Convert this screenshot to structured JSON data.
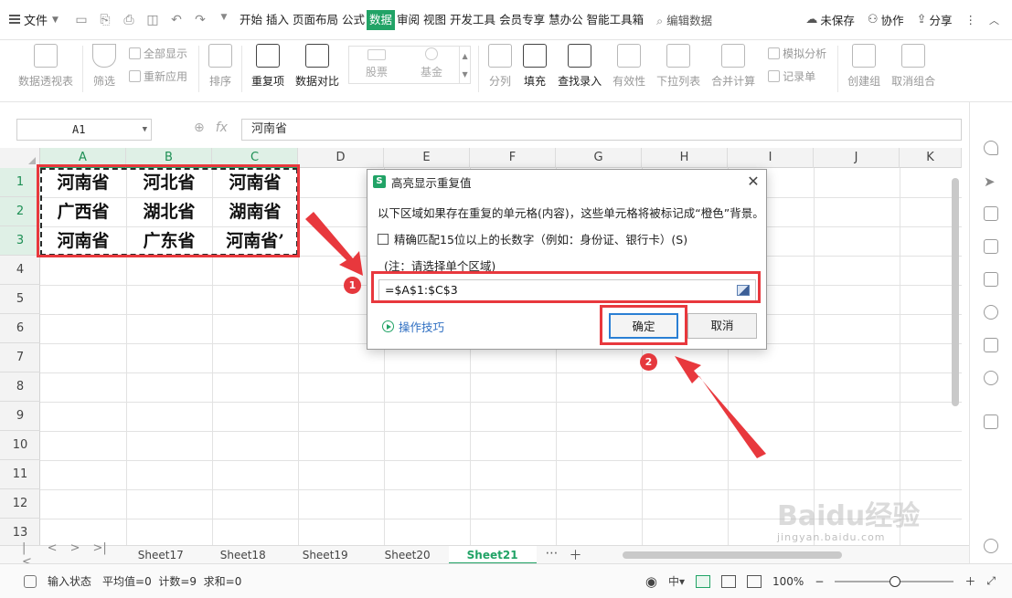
{
  "menu": {
    "file_label": "文件",
    "tabs": [
      "开始",
      "插入",
      "页面布局",
      "公式",
      "数据",
      "审阅",
      "视图",
      "开发工具",
      "会员专享",
      "慧办公",
      "智能工具箱"
    ],
    "active_tab": "数据",
    "command_search": "编辑数据",
    "unsaved": "未保存",
    "collab": "协作",
    "share": "分享"
  },
  "ribbon": {
    "pivot": "数据透视表",
    "filter": "筛选",
    "show_all": "全部显示",
    "reapply": "重新应用",
    "sort": "排序",
    "duplicates": "重复项",
    "compare": "数据对比",
    "stock": "股票",
    "fund": "基金",
    "split": "分列",
    "fill": "填充",
    "lookup": "查找录入",
    "validity": "有效性",
    "dropdown": "下拉列表",
    "consolidate": "合并计算",
    "simulate": "模拟分析",
    "record": "记录单",
    "group": "创建组",
    "ungroup": "取消组合"
  },
  "formula_bar": {
    "cell_ref": "A1",
    "fx": "fx",
    "content": "河南省"
  },
  "grid": {
    "columns": [
      "A",
      "B",
      "C",
      "D",
      "E",
      "F",
      "G",
      "H",
      "I",
      "J",
      "K"
    ],
    "rows": [
      "1",
      "2",
      "3",
      "4",
      "5",
      "6",
      "7",
      "8",
      "9",
      "10",
      "11",
      "12",
      "13"
    ],
    "cells": [
      [
        "河南省",
        "河北省",
        "河南省"
      ],
      [
        "广西省",
        "湖北省",
        "湖南省"
      ],
      [
        "河南省",
        "广东省",
        "河南省’"
      ]
    ]
  },
  "dialog": {
    "title": "高亮显示重复值",
    "description": "以下区域如果存在重复的单元格(内容)，这些单元格将被标记成“橙色”背景。",
    "checkbox_label": "精确匹配15位以上的长数字（例如：身份证、银行卡）(S)",
    "note": "(注：请选择单个区域)",
    "range_value": "=$A$1:$C$3",
    "tips_link": "操作技巧",
    "ok": "确定",
    "cancel": "取消"
  },
  "annotations": {
    "badge1": "1",
    "badge2": "2"
  },
  "sheets": {
    "tabs": [
      "Sheet17",
      "Sheet18",
      "Sheet19",
      "Sheet20",
      "Sheet21"
    ],
    "active": "Sheet21"
  },
  "status": {
    "mode": "输入状态",
    "stats": "平均值=0  计数=9  求和=0",
    "zoom": "100%"
  },
  "watermark": {
    "brand": "Baidu经验",
    "url": "jingyan.baidu.com"
  },
  "colors": {
    "accent": "#21a366",
    "annotation": "#e8383d",
    "link": "#2f6fc2"
  }
}
